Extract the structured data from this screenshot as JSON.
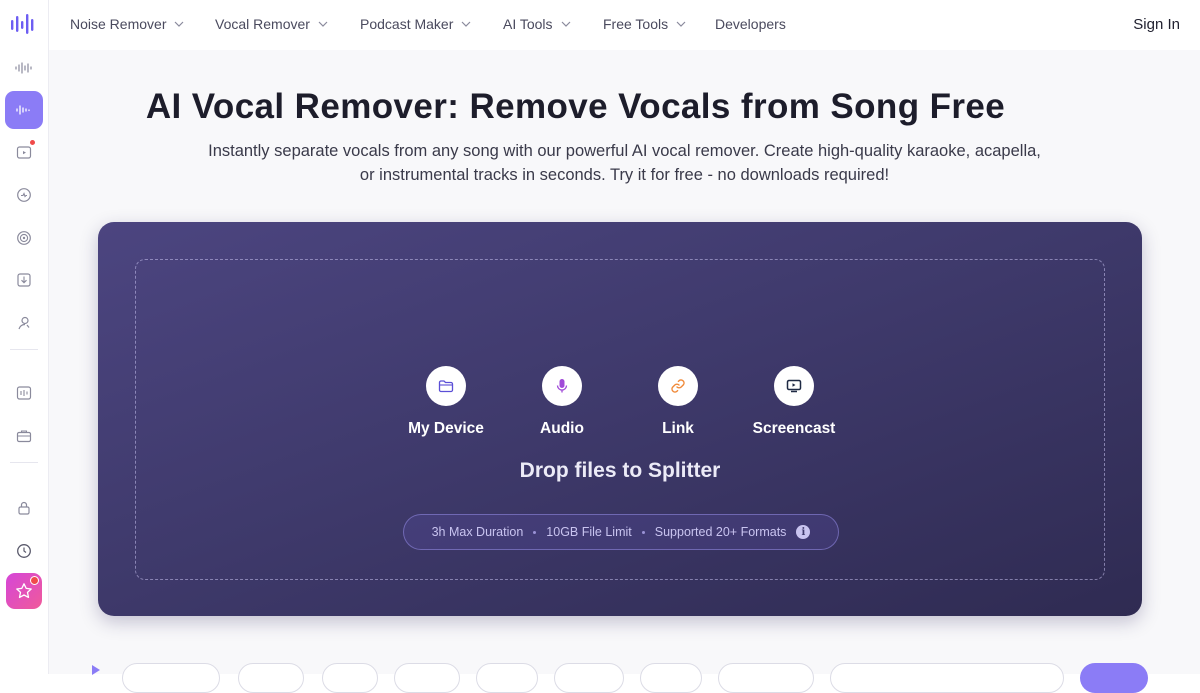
{
  "sidebar": {
    "items": [
      {
        "icon": "waveform-logo-icon"
      },
      {
        "icon": "sound-wave-icon"
      },
      {
        "icon": "vocal-remover-icon",
        "active": true
      },
      {
        "icon": "video-icon",
        "badge": true
      },
      {
        "icon": "speed-icon"
      },
      {
        "icon": "podcast-icon"
      },
      {
        "icon": "download-box-icon"
      },
      {
        "icon": "voice-user-icon"
      },
      {
        "icon": "audio-editor-icon"
      },
      {
        "icon": "toolbox-icon"
      },
      {
        "icon": "lock-icon"
      },
      {
        "icon": "clock-icon"
      },
      {
        "icon": "star-icon",
        "badge": true
      }
    ]
  },
  "nav": {
    "items": [
      {
        "label": "Noise Remover"
      },
      {
        "label": "Vocal Remover"
      },
      {
        "label": "Podcast Maker"
      },
      {
        "label": "AI Tools"
      },
      {
        "label": "Free Tools"
      },
      {
        "label": "Developers"
      }
    ],
    "sign_in": "Sign In"
  },
  "hero": {
    "title": "AI Vocal Remover: Remove Vocals from Song Free",
    "subtitle_line1": "Instantly separate vocals from any song with our powerful AI vocal remover. Create high-quality karaoke, acapella,",
    "subtitle_line2": "or instrumental tracks in seconds. Try it for free - no downloads required!"
  },
  "upload": {
    "sources": [
      {
        "label": "My Device",
        "icon": "folder-icon"
      },
      {
        "label": "Audio",
        "icon": "microphone-icon"
      },
      {
        "label": "Link",
        "icon": "link-icon"
      },
      {
        "label": "Screencast",
        "icon": "monitor-icon"
      }
    ],
    "drop_text": "Drop files to Splitter",
    "limits": [
      "3h Max Duration",
      "10GB File Limit",
      "Supported 20+ Formats"
    ],
    "info_glyph": "i"
  },
  "colors": {
    "accent": "#8b7cf6",
    "card_dark": "#3f3a6c",
    "badge_red": "#f04a4a"
  }
}
